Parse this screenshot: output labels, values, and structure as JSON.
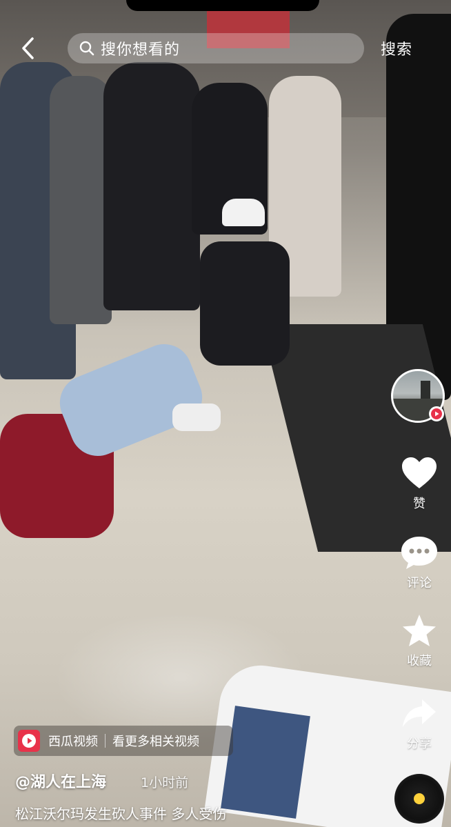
{
  "search": {
    "placeholder": "搜你想看的",
    "button": "搜索"
  },
  "rail": {
    "like": "赞",
    "comment": "评论",
    "favorite": "收藏",
    "share": "分享"
  },
  "source": {
    "app_name": "西瓜视频",
    "link": "看更多相关视频"
  },
  "post": {
    "author": "@湖人在上海",
    "time": "1小时前",
    "caption": "松江沃尔玛发生砍人事件 多人受伤"
  },
  "colors": {
    "accent": "#e8324a",
    "text": "#ffffff"
  }
}
